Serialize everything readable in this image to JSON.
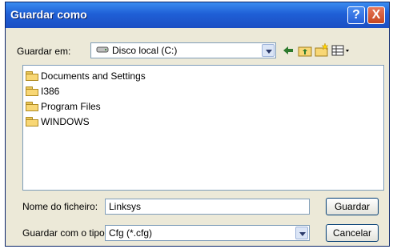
{
  "window": {
    "title": "Guardar como"
  },
  "titlebar": {
    "help_label": "?",
    "close_label": "X"
  },
  "look_in": {
    "label": "Guardar em:",
    "value": "Disco local (C:)"
  },
  "toolbar": {
    "icons": [
      "back-icon",
      "up-folder-icon",
      "new-folder-icon",
      "view-menu-icon"
    ]
  },
  "files": {
    "items": [
      {
        "name": "Documents and Settings"
      },
      {
        "name": "I386"
      },
      {
        "name": "Program Files"
      },
      {
        "name": "WINDOWS"
      }
    ]
  },
  "filename": {
    "label": "Nome do ficheiro:",
    "value": "Linksys"
  },
  "filetype": {
    "label": "Guardar com o tipo:",
    "value": "Cfg (*.cfg)"
  },
  "buttons": {
    "save": "Guardar",
    "cancel": "Cancelar"
  },
  "colors": {
    "titlebar": "#1f5fd6",
    "dialog": "#ece9d8",
    "folder": "#f8d775"
  }
}
